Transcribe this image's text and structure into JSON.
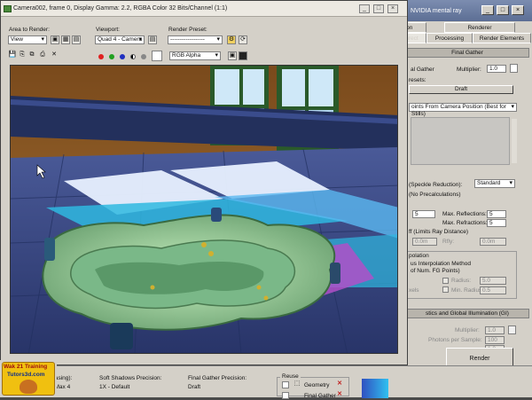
{
  "render_setup": {
    "title": "NVIDIA mental ray",
    "title_buttons": [
      "_",
      "□",
      "×"
    ],
    "tabs_row1": [
      "ion",
      "Renderer"
    ],
    "tabs_row2": [
      "Indirect Illumination",
      "Processing",
      "Render Elements"
    ],
    "final_gather_rollout": "Final Gather",
    "final_gather_label": "al Gather",
    "multiplier_label": "Multiplier:",
    "multiplier_value": "1.0",
    "presets_label": "resets:",
    "preset_value": "Draft",
    "project_points_value": "oints From Camera Position (Best for Stills)",
    "speckle_label": "(Speckle Reduction):",
    "speckle_value": "Standard",
    "precalc_label": "(No Precalculations)",
    "max_reflections_label": "Max. Reflections:",
    "max_reflections_value": "5",
    "max_refractions_label": "Max. Refractions:",
    "max_refractions_value": "5",
    "left_spin_value": "5",
    "limits_label": "ff (Limits Ray Distance)",
    "limit_left_value": "0.0m",
    "limit_right_label": "Rfly:",
    "limit_right_value": "0.0m",
    "interp_label": "polation",
    "interp_method": "us Interpolation Method",
    "interp_points": "of Num. FG Points)",
    "radius_label": "Radius:",
    "radius_value": "5.0",
    "min_radius_label": "Min. Radius:",
    "min_radius_value": "0.5",
    "pixels_label": "xels",
    "caustics_rollout": "stics and Global Illumination (GI)",
    "multiplier2_label": "Multiplier:",
    "multiplier2_value": "1.0",
    "photons_label": "Photons per Sample:",
    "photons_value": "100",
    "radius2_value": "1.0",
    "render_button": "Render"
  },
  "frame_window": {
    "title": "Camera002, frame 0, Display Gamma: 2.2, RGBA Color 32 Bits/Channel (1:1)",
    "area_label": "Area to Render:",
    "area_value": "View",
    "viewport_label": "Viewport:",
    "viewport_value": "Quad 4 - Camera",
    "preset_label": "Render Preset:",
    "preset_value": "------------------",
    "channel_value": "RGB Alpha"
  },
  "bottom_bar": {
    "aa_label": "(Antialiasing):",
    "aa_value": "Min 4, Max 4",
    "soft_label": "Soft Shadows Precision:",
    "soft_value": "1X - Default",
    "fg_label": "Final Gather Precision:",
    "fg_value": "Draft",
    "reuse_label": "Reuse",
    "geometry_label": "Geometry",
    "final_gather_label": "Final Gather",
    "logo_line1": "Wak 21 Training",
    "logo_line2": "Tutors3d.com"
  },
  "colors": {
    "title_bar": "#5c6e94",
    "panel": "#d4d0c8",
    "pool": "#a8d8a0",
    "floor_cyan": "#2fb8e0",
    "floor_blue": "#3a4a8a",
    "magenta": "#b050c8",
    "wall_brown": "#8a5a28"
  }
}
